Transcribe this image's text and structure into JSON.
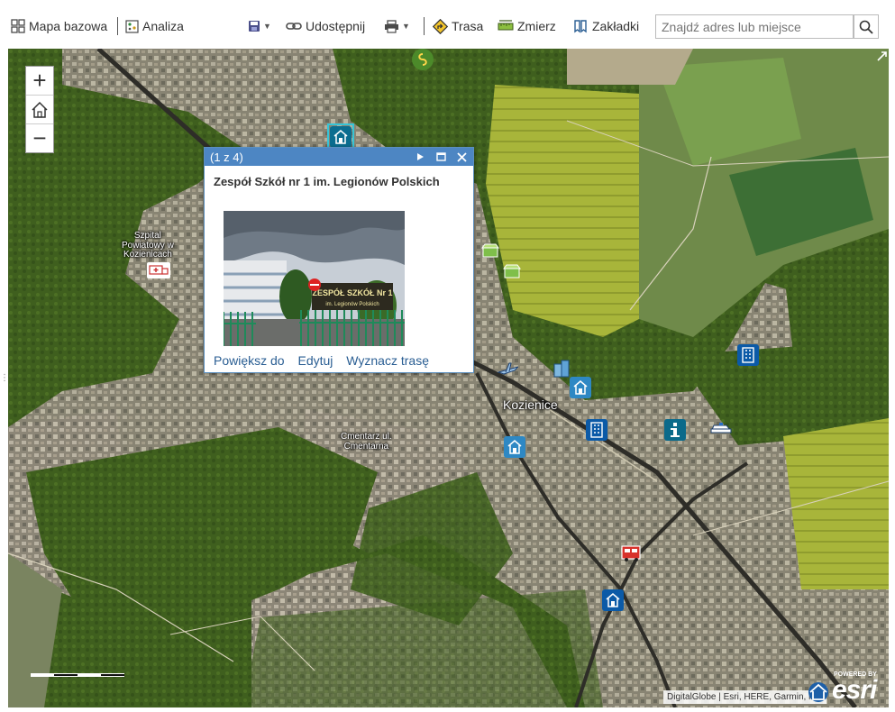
{
  "toolbar": {
    "basemap_label": "Mapa bazowa",
    "analysis_label": "Analiza",
    "share_label": "Udostępnij",
    "route_label": "Trasa",
    "measure_label": "Zmierz",
    "bookmarks_label": "Zakładki",
    "search_placeholder": "Znajdź adres lub miejsce"
  },
  "zoom": {
    "in": "+",
    "out": "−"
  },
  "popup": {
    "count": "(1 z 4)",
    "title": "Zespół Szkół nr 1 im. Legionów Polskich",
    "sign_line1": "ZESPÓŁ SZKÓŁ Nr 1",
    "sign_line2": "im. Legionów Polskich",
    "actions": {
      "zoom_to": "Powiększ do",
      "edit": "Edytuj",
      "directions": "Wyznacz trasę"
    }
  },
  "map": {
    "labels": {
      "hospital_line1": "Szpital",
      "hospital_line2": "Powiatowy w",
      "hospital_line3": "Kozienicach",
      "cemetery_line1": "Cmentarz ul.",
      "cemetery_line2": "Cmentarna",
      "city": "Kozienice"
    },
    "attribution": "DigitalGlobe | Esri, HERE, Garmin, iPC",
    "esri_powered": "POWERED BY",
    "esri_logo": "esri"
  },
  "colors": {
    "popup_header": "#4d86c3",
    "poi_blue": "#0b5aa7",
    "link": "#2a5e93"
  }
}
